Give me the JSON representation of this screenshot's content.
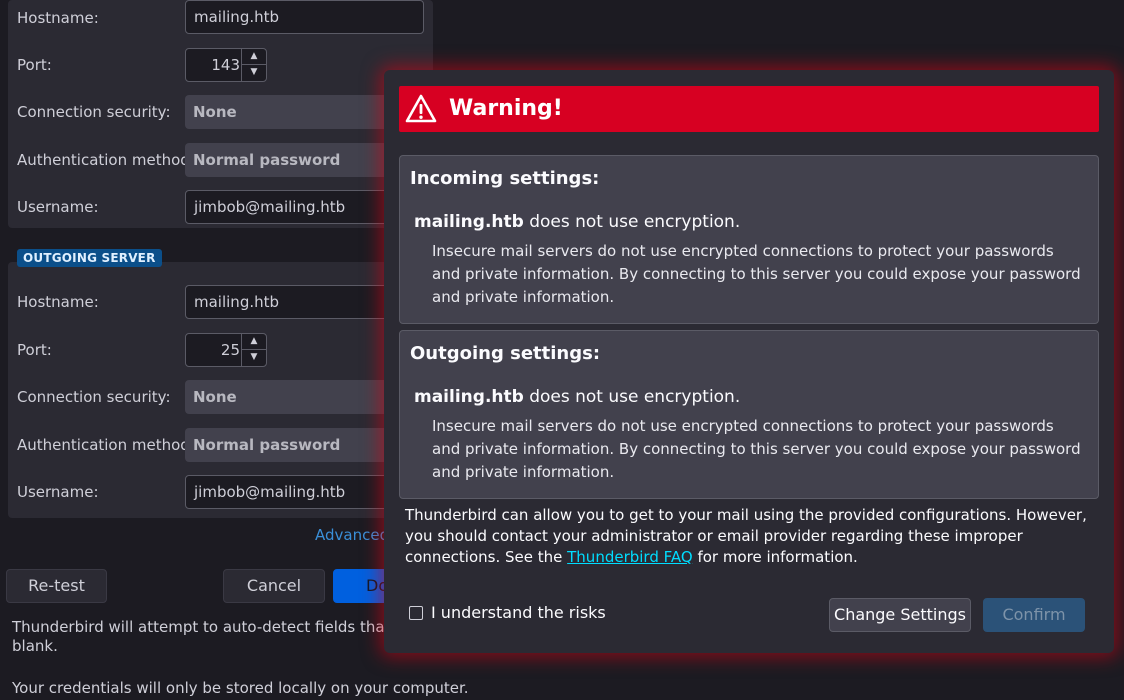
{
  "incoming": {
    "hostname_label": "Hostname:",
    "hostname_value": "mailing.htb",
    "port_label": "Port:",
    "port_value": "143",
    "security_label": "Connection security:",
    "security_value": "None",
    "auth_label": "Authentication method:",
    "auth_value": "Normal password",
    "username_label": "Username:",
    "username_value": "jimbob@mailing.htb"
  },
  "outgoing": {
    "badge": "OUTGOING SERVER",
    "hostname_label": "Hostname:",
    "hostname_value": "mailing.htb",
    "port_label": "Port:",
    "port_value": "25",
    "security_label": "Connection security:",
    "security_value": "None",
    "auth_label": "Authentication method:",
    "auth_value": "Normal password",
    "username_label": "Username:",
    "username_value": "jimbob@mailing.htb"
  },
  "background": {
    "advanced_link": "Advanced",
    "retest_button": "Re-test",
    "cancel_button": "Cancel",
    "done_button": "Do",
    "autodetect_note_1": "Thunderbird will attempt to auto-detect fields that are lef",
    "autodetect_note_2": "blank.",
    "credentials_note": "Your credentials will only be stored locally on your computer."
  },
  "dialog": {
    "title": "Warning!",
    "incoming": {
      "heading": "Incoming settings:",
      "host": "mailing.htb",
      "statement": " does not use encryption.",
      "description": "Insecure mail servers do not use encrypted connections to protect your passwords and private information. By connecting to this server you could expose your password and private information."
    },
    "outgoing": {
      "heading": "Outgoing settings:",
      "host": "mailing.htb",
      "statement": " does not use encryption.",
      "description": "Insecure mail servers do not use encrypted connections to protect your passwords and private information. By connecting to this server you could expose your password and private information."
    },
    "footer_text_before": "Thunderbird can allow you to get to your mail using the provided configurations. However, you should contact your administrator or email provider regarding these improper connections. See the ",
    "footer_link": "Thunderbird FAQ",
    "footer_text_after": " for more information.",
    "understand_label": "I understand the risks",
    "change_settings_button": "Change Settings",
    "confirm_button": "Confirm"
  },
  "colors": {
    "warning_bar": "#d70022",
    "glow": "#dc0014",
    "link": "#00ddff",
    "badge": "#0b4f8a",
    "confirm_disabled": "#2b5278"
  }
}
